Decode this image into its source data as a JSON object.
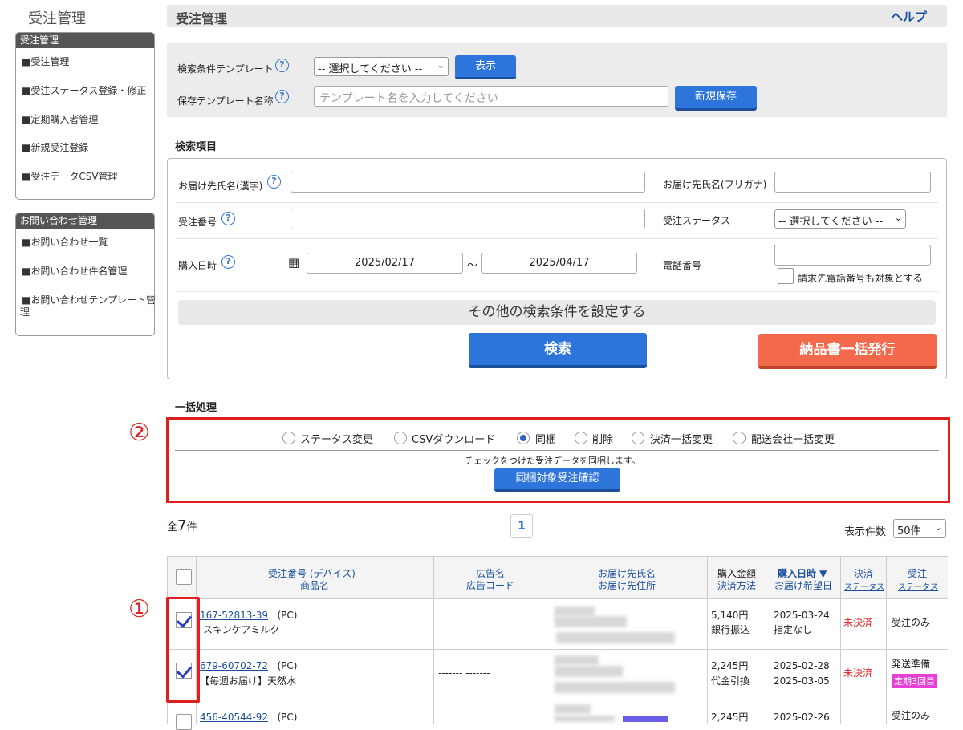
{
  "sidebar": {
    "title": "受注管理",
    "sections": [
      {
        "heading": "受注管理",
        "items": [
          "■受注管理",
          "■受注ステータス登録・修正",
          "■定期購入者管理",
          "■新規受注登録",
          "■受注データCSV管理"
        ]
      },
      {
        "heading": "お問い合わせ管理",
        "items": [
          "■お問い合わせ一覧",
          "■お問い合わせ件名管理",
          "■お問い合わせテンプレート管",
          "理"
        ]
      }
    ]
  },
  "header": {
    "title": "受注管理",
    "help": "ヘルプ"
  },
  "template": {
    "condition_label": "検索条件テンプレート",
    "condition_select": "-- 選択してください --",
    "show_button": "表示",
    "name_label": "保存テンプレート名称",
    "name_placeholder": "テンプレート名を入力してください",
    "save_button": "新規保存"
  },
  "search": {
    "title": "検索項目",
    "recipient_kanji": "お届け先氏名(漢字)",
    "recipient_kana": "お届け先氏名(フリガナ)",
    "order_number": "受注番号",
    "order_status": "受注ステータス",
    "order_status_select": "-- 選択してください --",
    "purchase_date": "購入日時",
    "date_from": "2025/02/17",
    "date_sep": "～",
    "date_to": "2025/04/17",
    "phone": "電話番号",
    "phone_billing": "請求先電話番号も対象とする",
    "more_conditions": "その他の検索条件を設定する",
    "search_button": "検索",
    "delivery_button": "納品書一括発行"
  },
  "bulk": {
    "title": "一括処理",
    "options": [
      "ステータス変更",
      "CSVダウンロード",
      "同梱",
      "削除",
      "決済一括変更",
      "配送会社一括変更"
    ],
    "selected": "同梱",
    "description": "チェックをつけた受注データを同梱します。",
    "confirm_button": "同梱対象受注確認",
    "marker_2": "②",
    "marker_1": "①"
  },
  "results": {
    "total_prefix": "全",
    "total_count": "7",
    "total_suffix": "件",
    "page": "1",
    "per_page_label": "表示件数",
    "per_page_value": "50件"
  },
  "table": {
    "headers": {
      "order_no": "受注番号 (デバイス)",
      "product": "商品名",
      "ad_name": "広告名",
      "ad_code": "広告コード",
      "recipient_name": "お届け先氏名",
      "recipient_addr": "お届け先住所",
      "amount": "購入金額",
      "payment_method": "決済方法",
      "purchase_date": "購入日時 ▼",
      "desired_date": "お届け希望日",
      "payment": "決済",
      "payment_status": "ステータス",
      "order": "受注",
      "order_status": "ステータス"
    },
    "rows": [
      {
        "order_no": "167-52813-39",
        "device": "(PC)",
        "product": "スキンケアミルク",
        "ad": "------- -------",
        "amount": "5,140円",
        "method": "銀行振込",
        "date": "2025-03-24",
        "desired": "指定なし",
        "payment_status": "未決済",
        "order_status": "受注のみ",
        "tag": ""
      },
      {
        "order_no": "679-60702-72",
        "device": "(PC)",
        "product": "【毎週お届け】天然水",
        "ad": "------- -------",
        "amount": "2,245円",
        "method": "代金引換",
        "date": "2025-02-28",
        "desired": "2025-03-05",
        "payment_status": "未決済",
        "order_status": "発送準備",
        "tag": "定期3回目"
      },
      {
        "order_no": "456-40544-92",
        "device": "(PC)",
        "product": "",
        "ad": "",
        "amount": "2,245円",
        "method": "",
        "date": "2025-02-26",
        "desired": "",
        "payment_status": "",
        "order_status": "受注のみ",
        "tag": ""
      }
    ]
  },
  "colors": {
    "accent_blue": "#2d74db",
    "alert_red": "#e02020",
    "orange": "#f26a4b",
    "pink_tag": "#e83fd7"
  }
}
